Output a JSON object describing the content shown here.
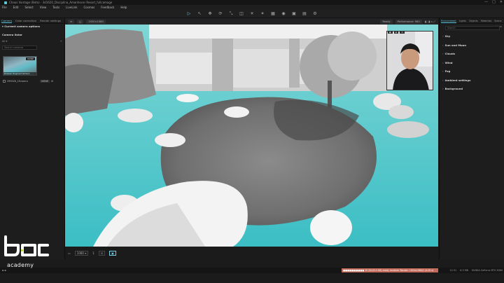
{
  "window": {
    "title": "Chaos Vantage (Beta) - 3d1620_Disciplina_Amanhecer Resort_fullcamage"
  },
  "menu": [
    "File",
    "Edit",
    "Select",
    "View",
    "Tools",
    "LiveLink",
    "Cosmos",
    "Feedback",
    "Help"
  ],
  "toolbar": {
    "icons": [
      "play-icon",
      "select-icon",
      "move-icon",
      "rotate-icon",
      "scale-icon",
      "camera-icon",
      "light-icon",
      "sun-icon",
      "grid-icon",
      "render-icon",
      "snapshot-icon",
      "sequence-icon",
      "settings-icon"
    ],
    "active_index": 0
  },
  "viewport_strip": {
    "chip1": "≡",
    "chip2": "◱",
    "res": "1920×1080",
    "quality": "Ready",
    "mode": "Performance: 960",
    "icons": "◧ ◨ ⌂ ⤢"
  },
  "left_panel": {
    "tabs": [
      "Camera",
      "Color correction",
      "Render settings"
    ],
    "section_current": "Current camera options",
    "section_list": "Camera listor",
    "filter_label": "All",
    "search_placeholder": "Search cameras",
    "camera_caption": "Drawer Original Camera",
    "camera_badge": "NONE",
    "camera_item_label": "299026_1Ecamra",
    "camera_item_value": "NONE"
  },
  "right_panel": {
    "tabs": [
      "Environment",
      "Lights",
      "Objects",
      "Materials",
      "Scene states"
    ],
    "search_placeholder": "Search",
    "sections": [
      "Sky",
      "Sun and Moon",
      "Clouds",
      "Wind",
      "Fog",
      "Ambient settings",
      "Background"
    ]
  },
  "viewport_bottom": {
    "frame": "1080 ▾",
    "zoom": "1",
    "btn_a": "⊡",
    "btn_b": "▣"
  },
  "status": {
    "left": "▪ ▪",
    "progress_text": "■■■■■■■■■■ 10 (8:0/5.0 GB) ready renderer Render: 1920x1080/1 (4.00 s)",
    "time": "12:31",
    "fps": "6.3 MB",
    "gpu": "NVIDIA GeForce RTX 3060"
  },
  "logo": {
    "word": "academy"
  },
  "colors": {
    "accent": "#61c6dc",
    "water": "#49c3c9",
    "status_bar": "#c26b5a"
  }
}
